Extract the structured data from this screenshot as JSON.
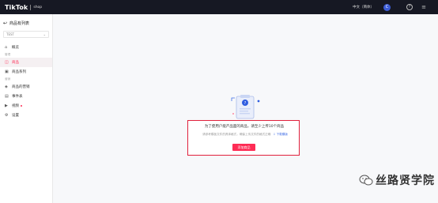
{
  "topbar": {
    "brand": "TikTok",
    "brand_sub": "shop",
    "language": "中文（简体）",
    "avatar_letter": "C",
    "help_icon": "question-icon",
    "menu_icon": "menu-icon"
  },
  "sidebar": {
    "title": "商品有列表",
    "back_icon": "back-arrow-icon",
    "shop_select": "TEST",
    "group1": "管理",
    "group2": "营销",
    "items": [
      {
        "label": "概览",
        "icon": "home-icon"
      },
      {
        "label": "商品",
        "icon": "bag-icon"
      },
      {
        "label": "商品系列",
        "icon": "collection-icon"
      },
      {
        "label": "商品的营销",
        "icon": "tag-icon"
      },
      {
        "label": "事件表",
        "icon": "list-icon"
      },
      {
        "label": "视频",
        "icon": "video-icon"
      },
      {
        "label": "设置",
        "icon": "gear-icon"
      }
    ]
  },
  "empty_state": {
    "title": "为了使用户能产品面的商品，请至少上传10个商品",
    "desc": "请参考模板文件的具体格式，确保上传文件的格式正确",
    "link": "下载模版",
    "button": "添加商品"
  },
  "watermark": {
    "text": "丝路贤学院"
  },
  "colors": {
    "accent": "#fe2c55",
    "topbar": "#161823",
    "highlight_border": "#e0203c",
    "link": "#3d6be5"
  }
}
